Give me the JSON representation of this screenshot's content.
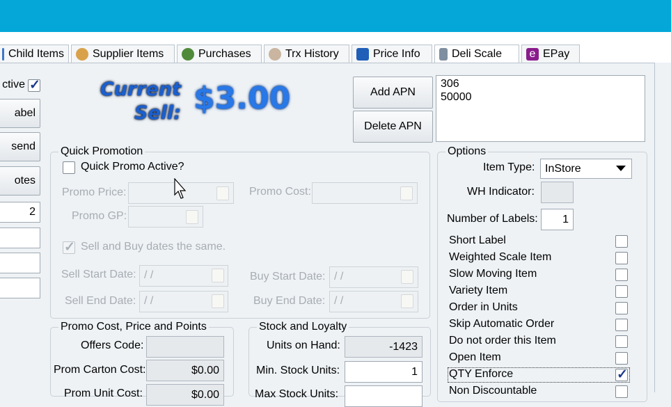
{
  "tabs": [
    {
      "label": "Child Items",
      "icon": "child-items-icon"
    },
    {
      "label": "Supplier Items",
      "icon": "supplier-items-icon"
    },
    {
      "label": "Purchases",
      "icon": "purchases-icon"
    },
    {
      "label": "Trx History",
      "icon": "trx-history-icon"
    },
    {
      "label": "Price Info",
      "icon": "price-info-icon"
    },
    {
      "label": "Deli Scale",
      "icon": "deli-scale-icon"
    },
    {
      "label": "EPay",
      "icon": "epay-icon"
    }
  ],
  "left": {
    "active_label": "ctive",
    "active_checked": true,
    "label_button": "abel",
    "resend_button": "send",
    "notes_button": "otes",
    "number_value": "2"
  },
  "current_sell": {
    "label_line1": "Current",
    "label_line2": "Sell:",
    "value": "$3.00"
  },
  "apn": {
    "add_button": "Add APN",
    "delete_button": "Delete APN",
    "codes": [
      "306",
      "50000"
    ]
  },
  "quick_promotion": {
    "title": "Quick Promotion",
    "active_label": "Quick Promo Active?",
    "promo_price_label": "Promo Price:",
    "promo_cost_label": "Promo Cost:",
    "promo_gp_label": "Promo GP:",
    "same_dates_label": "Sell and Buy dates the same.",
    "sell_start_label": "Sell Start Date:",
    "sell_end_label": "Sell End Date:",
    "buy_start_label": "Buy Start Date:",
    "buy_end_label": "Buy End Date:",
    "date_placeholder": " / /"
  },
  "promo_cost": {
    "title": "Promo Cost, Price and Points",
    "offers_code_label": "Offers Code:",
    "offers_code_value": "",
    "carton_cost_label": "Prom Carton Cost:",
    "carton_cost_value": "$0.00",
    "unit_cost_label": "Prom Unit Cost:",
    "unit_cost_value": "$0.00"
  },
  "stock": {
    "title": "Stock and Loyalty",
    "units_on_hand_label": "Units on Hand:",
    "units_on_hand_value": "-1423",
    "min_stock_label": "Min. Stock Units:",
    "min_stock_value": "1",
    "max_stock_label": "Max Stock Units:"
  },
  "options": {
    "title": "Options",
    "item_type_label": "Item Type:",
    "item_type_value": "InStore",
    "wh_indicator_label": "WH Indicator:",
    "num_labels_label": "Number of Labels:",
    "num_labels_value": "1",
    "checks": [
      {
        "label": "Short Label",
        "checked": false
      },
      {
        "label": "Weighted Scale Item",
        "checked": false
      },
      {
        "label": "Slow Moving Item",
        "checked": false
      },
      {
        "label": "Variety Item",
        "checked": false
      },
      {
        "label": "Order in Units",
        "checked": false
      },
      {
        "label": "Skip Automatic Order",
        "checked": false
      },
      {
        "label": "Do not order this Item",
        "checked": false
      },
      {
        "label": "Open Item",
        "checked": false
      },
      {
        "label": "QTY Enforce",
        "checked": true
      },
      {
        "label": "Non Discountable",
        "checked": false
      }
    ]
  },
  "colors": {
    "title_bar": "#05a7d9",
    "price_blue": "#2878e8"
  }
}
